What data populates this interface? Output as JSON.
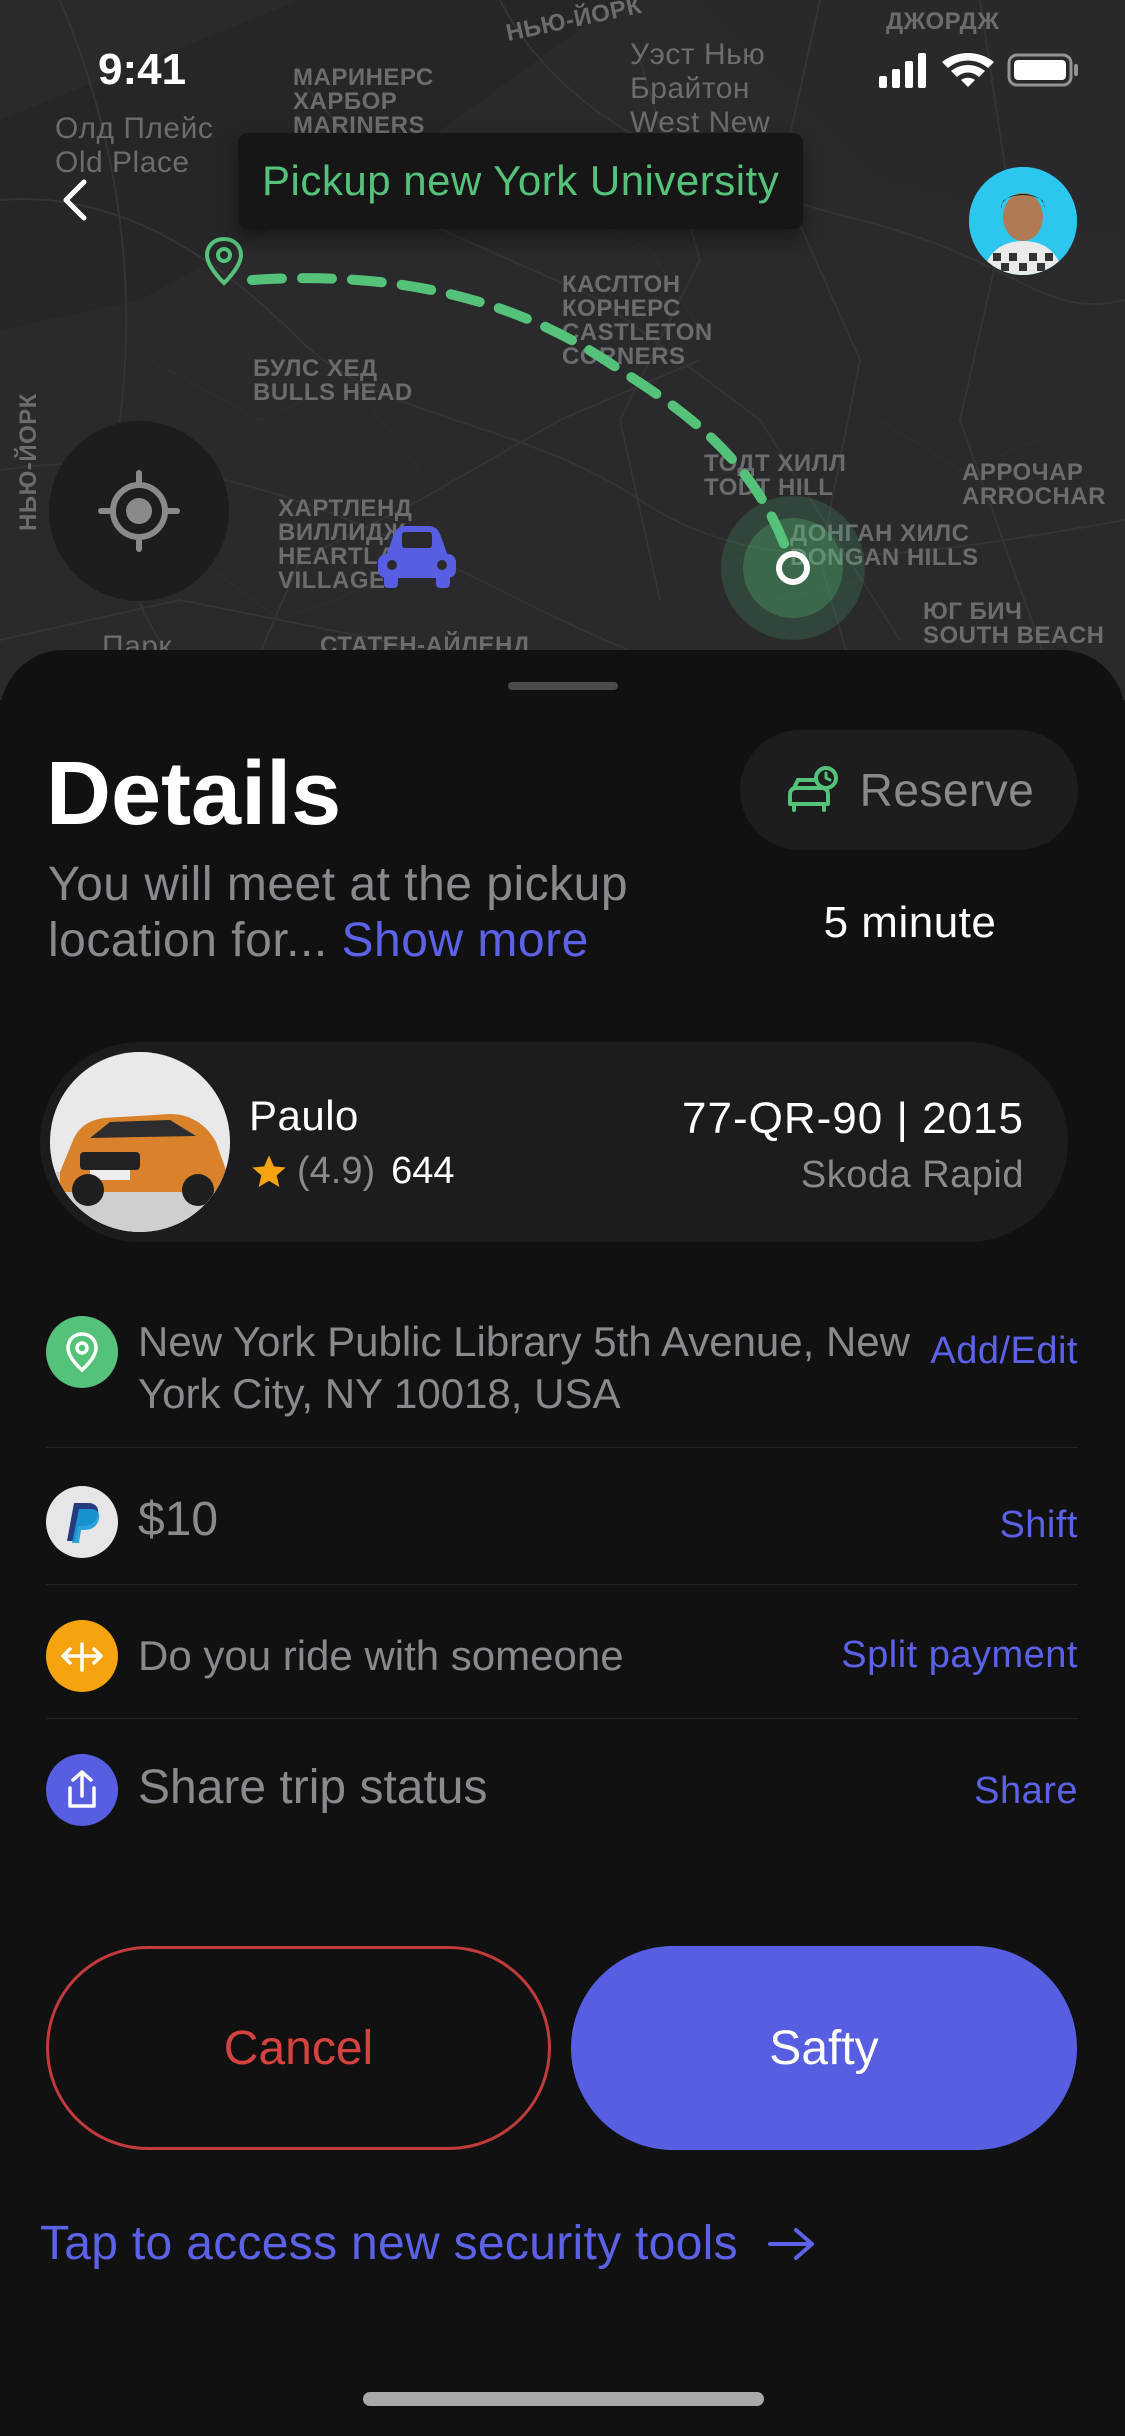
{
  "status_bar": {
    "time": "9:41",
    "icons": [
      "signal-icon",
      "wifi-icon",
      "battery-icon"
    ]
  },
  "map": {
    "banner": "Pickup new York University",
    "labels": [
      "НЬЮ-ЙОРК",
      "Уэст Нью\nБрайтон\nWest New",
      "ДЖОРДЖ",
      "МАРИНЕРС\nХАРБОР\nMARINERS",
      "Олд Плейс\nOld Place",
      "КАСЛТОН\nКОРНЕРС\nCASTLETON\nCORNERS",
      "БУЛС ХЕД\nBULLS HEAD",
      "ТОДТ ХИЛЛ\nTODT HILL",
      "АРРОЧАР\nARROCHAR",
      "ХАРТЛЕНД\nВИЛЛИДЖ\nHEARTLAND\nVILLAGE",
      "ДОНГАН ХИЛС\nDONGAN HILLS",
      "ЮГ БИЧ\nSOUTH BEACH",
      "НЬЮ-ЙОРК",
      "Парк",
      "СТАТЕН-АЙЛЕНД"
    ],
    "route_color": "#55c27a"
  },
  "details": {
    "title": "Details",
    "subtitle": "You will meet at the pickup location for...",
    "show_more": "Show more",
    "reserve_label": "Reserve",
    "eta": "5 minute"
  },
  "driver": {
    "name": "Paulo",
    "rating": "(4.9)",
    "trips": "644",
    "plate": "77-QR-90 | 2015",
    "car_model": "Skoda Rapid"
  },
  "rows": [
    {
      "icon": "location-pin-icon",
      "icon_color": "#55c27a",
      "text": "New York Public Library 5th Avenue, New York City, NY 10018, USA",
      "action": "Add/Edit"
    },
    {
      "icon": "paypal-icon",
      "icon_color": "#e6e6e8",
      "text": "$10",
      "action": "Shift"
    },
    {
      "icon": "split-arrows-icon",
      "icon_color": "#f5a30f",
      "text": "Do you ride with someone",
      "action": "Split payment"
    },
    {
      "icon": "share-icon",
      "icon_color": "#575ee1",
      "text": "Share trip status",
      "action": "Share"
    }
  ],
  "buttons": {
    "cancel": "Cancel",
    "safety": "Safty"
  },
  "security_link": "Tap to access new security tools",
  "colors": {
    "accent": "#575ee1",
    "success": "#55c27a",
    "danger": "#d6433e",
    "background": "#111112"
  }
}
